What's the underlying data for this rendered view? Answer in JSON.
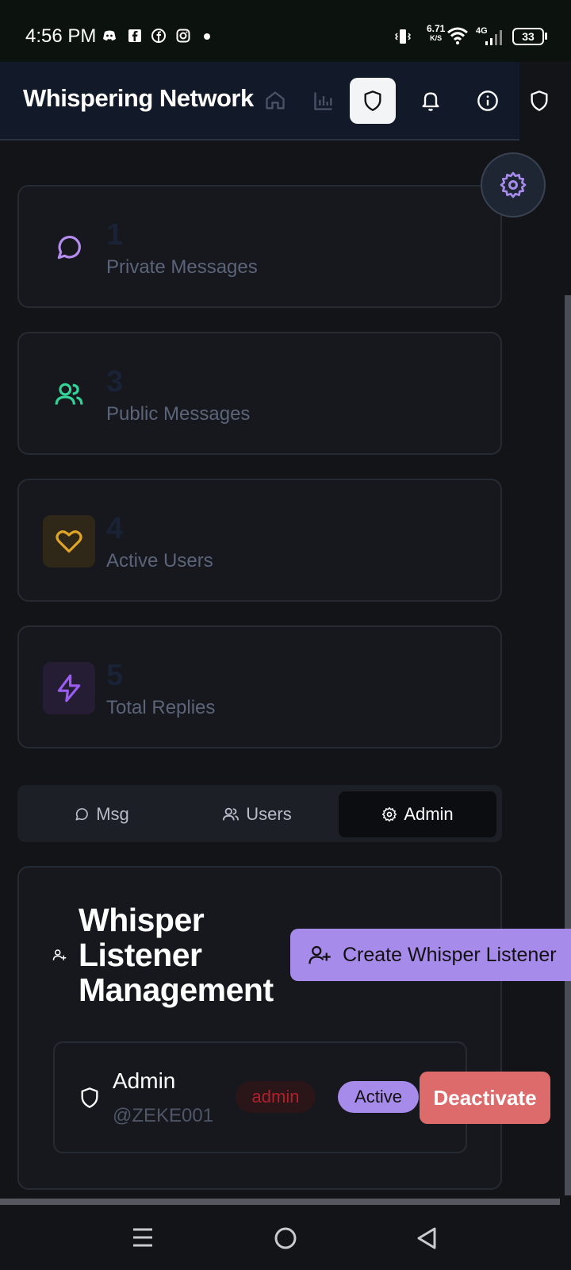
{
  "status_bar": {
    "time": "4:56 PM",
    "net_speed_value": "6.71",
    "net_speed_unit": "K/S",
    "network_type": "4G",
    "battery": "33"
  },
  "header": {
    "title": "Whispering Network",
    "nav": [
      {
        "icon": "home-icon"
      },
      {
        "icon": "bar-chart-icon"
      },
      {
        "icon": "shield-icon",
        "active": true
      },
      {
        "icon": "bell-icon"
      },
      {
        "icon": "info-icon"
      },
      {
        "icon": "shield-icon"
      }
    ]
  },
  "stats": [
    {
      "value": "1",
      "label": "Private Messages",
      "icon": "message-circle-icon",
      "color": "#b58cf0"
    },
    {
      "value": "3",
      "label": "Public Messages",
      "icon": "users-icon",
      "color": "#34d399"
    },
    {
      "value": "4",
      "label": "Active Users",
      "icon": "heart-icon",
      "color": "#e0a526"
    },
    {
      "value": "5",
      "label": "Total Replies",
      "icon": "zap-icon",
      "color": "#9b5cf2"
    }
  ],
  "tabs": [
    {
      "label": "Msg",
      "icon": "message-circle-icon"
    },
    {
      "label": "Users",
      "icon": "users-icon"
    },
    {
      "label": "Admin",
      "icon": "gear-icon",
      "active": true
    }
  ],
  "management": {
    "title": "Whisper Listener Management",
    "create_button": "Create Whisper Listener",
    "users": [
      {
        "name": "Admin",
        "handle": "@ZEKE001",
        "role": "admin",
        "status": "Active",
        "action": "Deactivate"
      }
    ]
  },
  "colors": {
    "accent": "#a78bea",
    "danger": "#dd6b6b",
    "background": "#131418"
  }
}
